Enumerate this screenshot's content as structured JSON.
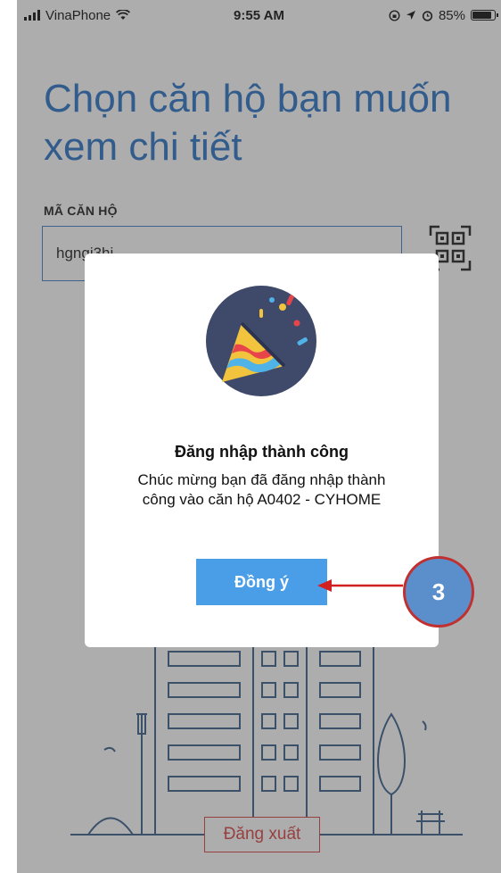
{
  "status_bar": {
    "carrier": "VinaPhone",
    "time": "9:55 AM",
    "battery": "85%",
    "battery_level": 0.85
  },
  "page": {
    "title_line1": "Chọn căn hộ bạn muốn",
    "title_line2": "xem chi tiết",
    "field_label": "MÃ CĂN HỘ",
    "field_value": "hgngi3hi",
    "logout_label": "Đăng xuất"
  },
  "dialog": {
    "title": "Đăng nhập thành công",
    "message": "Chúc mừng bạn đã đăng nhập thành công vào căn hộ A0402 - CYHOME",
    "ok_label": "Đồng ý"
  },
  "annotation": {
    "step": "3"
  },
  "colors": {
    "accent": "#2b74c7",
    "button": "#4a9ee8",
    "logout": "#d94444",
    "annotation_circle": "#5b8fcb",
    "annotation_arrow": "#d21f1f"
  }
}
